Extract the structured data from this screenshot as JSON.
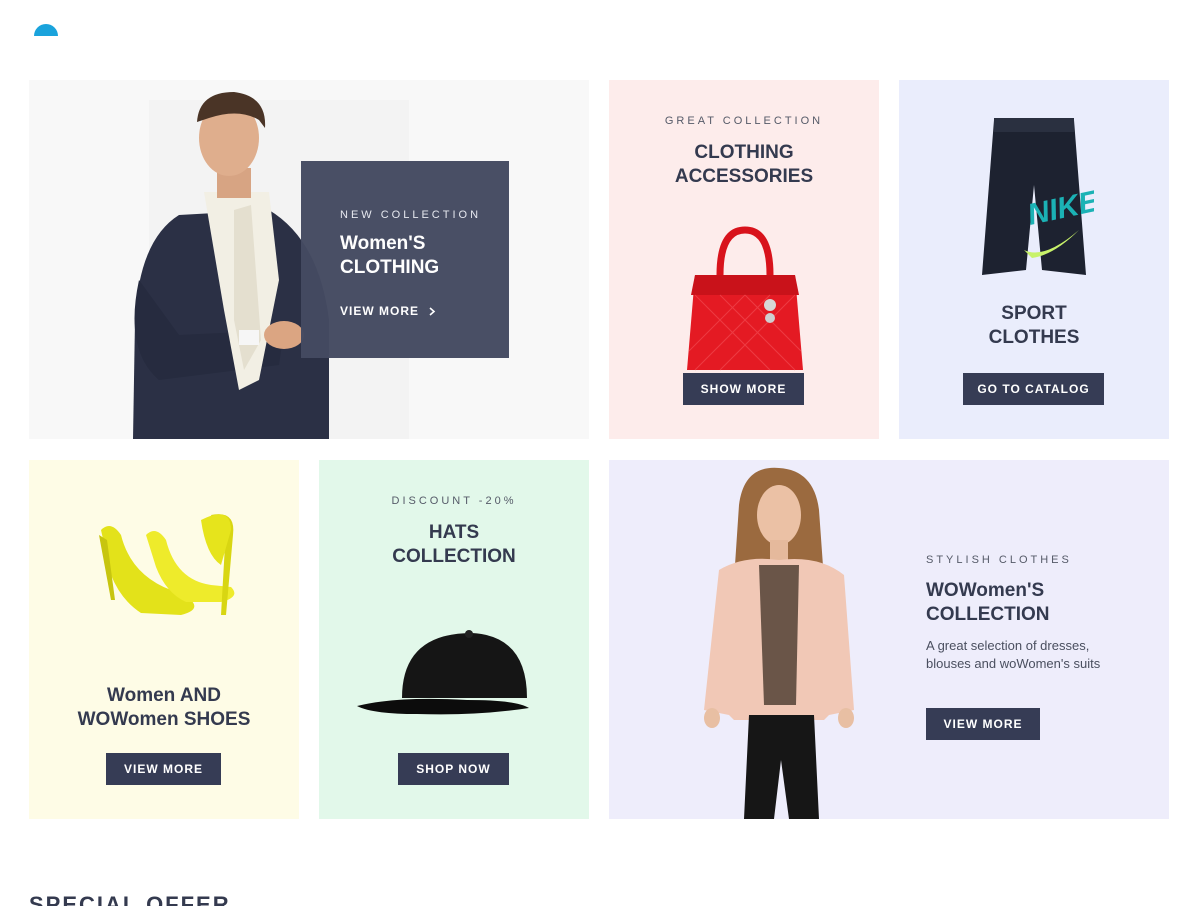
{
  "logo": {
    "icon": "logo-icon",
    "color": "#1aa3dc"
  },
  "cards": {
    "womens": {
      "eyebrow": "NEW COLLECTION",
      "title_line1": "Women'S",
      "title_line2": "CLOTHING",
      "link": "VIEW MORE",
      "link_icon": "chevron-right-icon"
    },
    "accessories": {
      "eyebrow": "GREAT COLLECTION",
      "title_line1": "CLOTHING",
      "title_line2": "ACCESSORIES",
      "button": "SHOW MORE"
    },
    "sport": {
      "title_line1": "SPORT",
      "title_line2": "CLOTHES",
      "button": "GO TO CATALOG",
      "brand": "NIKE"
    },
    "shoes": {
      "title_line1": "Women AND",
      "title_line2": "WOWomen SHOES",
      "button": "VIEW MORE"
    },
    "hats": {
      "eyebrow": "DISCOUNT -20%",
      "title_line1": "HATS",
      "title_line2": "COLLECTION",
      "button": "SHOP NOW"
    },
    "stylish": {
      "eyebrow": "STYLISH CLOTHES",
      "title_line1": "WOWomen'S",
      "title_line2": "COLLECTION",
      "desc_line1": "A great selection of dresses,",
      "desc_line2": "blouses and woWomen's suits",
      "button": "VIEW MORE"
    }
  },
  "section": {
    "title": "SPECIAL OFFER"
  },
  "colors": {
    "button": "#363c55",
    "overlay": "#444a61"
  }
}
